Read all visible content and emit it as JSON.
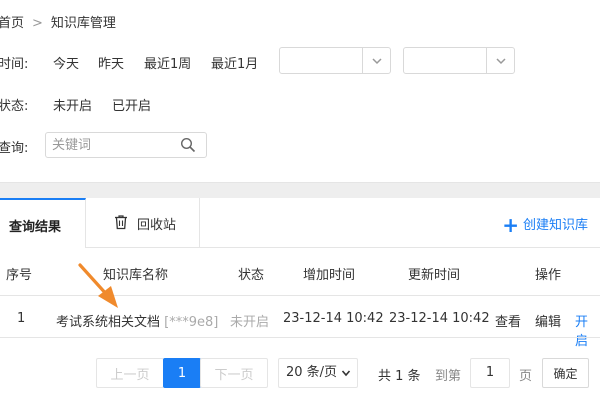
{
  "breadcrumb": {
    "home": "首页",
    "separator": ">",
    "current": "知识库管理"
  },
  "filters": {
    "time": {
      "label": "时间:",
      "options": [
        "今天",
        "昨天",
        "最近1周",
        "最近1月"
      ],
      "start_value": "",
      "end_value": ""
    },
    "status": {
      "label": "状态:",
      "options": [
        "未开启",
        "已开启"
      ]
    },
    "query": {
      "label": "查询:",
      "placeholder": "关键词",
      "value": ""
    }
  },
  "tabs": {
    "results": "查询结果",
    "recycle": "回收站",
    "create": "创建知识库"
  },
  "table": {
    "headers": [
      "序号",
      "知识库名称",
      "状态",
      "增加时间",
      "更新时间",
      "操作"
    ],
    "rows": [
      {
        "index": "1",
        "name": "考试系统相关文档",
        "name_masked": "[***9e8]",
        "status": "未开启",
        "added": "23-12-14 10:42",
        "updated": "23-12-14 10:42",
        "actions": [
          "查看",
          "编辑",
          "开启"
        ]
      }
    ]
  },
  "pager": {
    "prev": "上一页",
    "current_page": "1",
    "next": "下一页",
    "page_size": "20 条/页",
    "total": "共 1 条",
    "goto_label": "到第",
    "goto_value": "1",
    "page_unit": "页",
    "confirm": "确定"
  },
  "colors": {
    "accent": "#1a7ef5",
    "callout": "#f08a2c",
    "border": "#e5e5e5"
  }
}
